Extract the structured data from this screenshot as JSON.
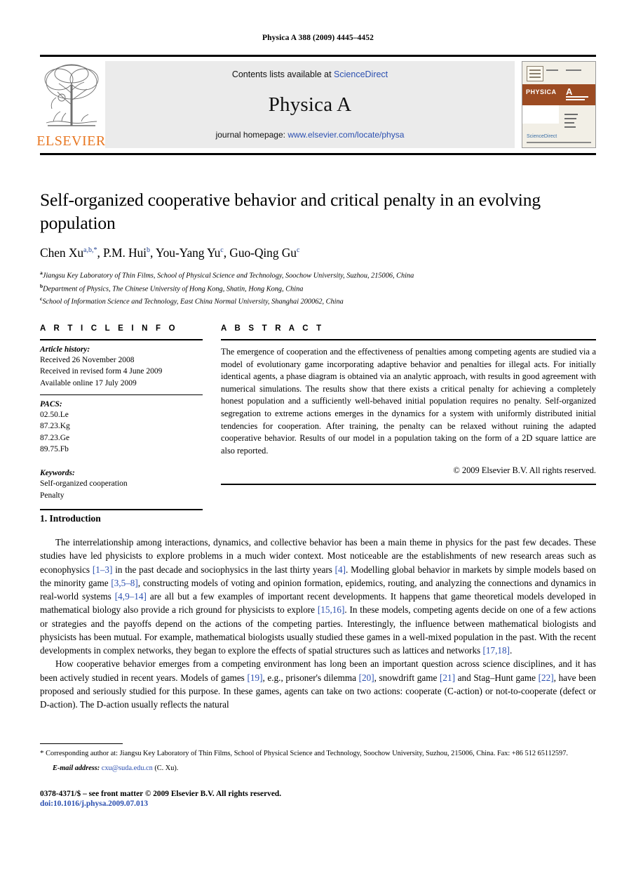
{
  "running_head": "Physica A 388 (2009) 4445–4452",
  "masthead": {
    "publisher_name": "ELSEVIER",
    "contents_prefix": "Contents lists available at ",
    "contents_link": "ScienceDirect",
    "journal_title": "Physica A",
    "homepage_prefix": "journal homepage: ",
    "homepage_link": "www.elsevier.com/locate/physa",
    "cover": {
      "brand": "PHYSICA",
      "brand_letter": "A",
      "sciencedirect_label": "ScienceDirect"
    }
  },
  "article": {
    "title": "Self-organized cooperative behavior and critical penalty in an evolving population",
    "authors_html": "Chen Xu<sup>a,b,*</sup>, P.M. Hui<sup>b</sup>, You-Yang Yu<sup>c</sup>, Guo-Qing Gu<sup>c</sup>",
    "affiliations": [
      {
        "marker": "a",
        "text": "Jiangsu Key Laboratory of Thin Films, School of Physical Science and Technology, Soochow University, Suzhou, 215006, China"
      },
      {
        "marker": "b",
        "text": "Department of Physics, The Chinese University of Hong Kong, Shatin, Hong Kong, China"
      },
      {
        "marker": "c",
        "text": "School of Information Science and Technology, East China Normal University, Shanghai 200062, China"
      }
    ]
  },
  "info": {
    "heading": "A R T I C L E   I N F O",
    "history_label": "Article history:",
    "history": [
      "Received 26 November 2008",
      "Received in revised form 4 June 2009",
      "Available online 17 July 2009"
    ],
    "pacs_label": "PACS:",
    "pacs": [
      "02.50.Le",
      "87.23.Kg",
      "87.23.Ge",
      "89.75.Fb"
    ],
    "keywords_label": "Keywords:",
    "keywords": [
      "Self-organized cooperation",
      "Penalty"
    ]
  },
  "abstract": {
    "heading": "A B S T R A C T",
    "text": "The emergence of cooperation and the effectiveness of penalties among competing agents are studied via a model of evolutionary game incorporating adaptive behavior and penalties for illegal acts. For initially identical agents, a phase diagram is obtained via an analytic approach, with results in good agreement with numerical simulations. The results show that there exists a critical penalty for achieving a completely honest population and a sufficiently well-behaved initial population requires no penalty. Self-organized segregation to extreme actions emerges in the dynamics for a system with uniformly distributed initial tendencies for cooperation. After training, the penalty can be relaxed without ruining the adapted cooperative behavior. Results of our model in a population taking on the form of a 2D square lattice are also reported.",
    "copyright": "© 2009 Elsevier B.V. All rights reserved."
  },
  "section": {
    "number_title": "1. Introduction",
    "paragraph_1_html": "The interrelationship among interactions, dynamics, and collective behavior has been a main theme in physics for the past few decades. These studies have led physicists to explore problems in a much wider context. Most noticeable are the establishments of new research areas such as econophysics <span class=\"cite\">[1–3]</span> in the past decade and sociophysics in the last thirty years <span class=\"cite\">[4]</span>. Modelling global behavior in markets by simple models based on the minority game <span class=\"cite\">[3,5–8]</span>, constructing models of voting and opinion formation, epidemics, routing, and analyzing the connections and dynamics in real-world systems <span class=\"cite\">[4,9–14]</span> are all but a few examples of important recent developments. It happens that game theoretical models developed in mathematical biology also provide a rich ground for physicists to explore <span class=\"cite\">[15,16]</span>. In these models, competing agents decide on one of a few actions or strategies and the payoffs depend on the actions of the competing parties. Interestingly, the influence between mathematical biologists and physicists has been mutual. For example, mathematical biologists usually studied these games in a well-mixed population in the past. With the recent developments in complex networks, they began to explore the effects of spatial structures such as lattices and networks <span class=\"cite\">[17,18]</span>.",
    "paragraph_2_html": "How cooperative behavior emerges from a competing environment has long been an important question across science disciplines, and it has been actively studied in recent years. Models of games <span class=\"cite\">[19]</span>, e.g., prisoner's dilemma <span class=\"cite\">[20]</span>, snowdrift game <span class=\"cite\">[21]</span> and Stag–Hunt game <span class=\"cite\">[22]</span>, have been proposed and seriously studied for this purpose. In these games, agents can take on two actions: cooperate (C-action) or not-to-cooperate (defect or D-action). The D-action usually reflects the natural"
  },
  "footnotes": {
    "corresponding_html": "<span class=\"star\">*</span> Corresponding author at: Jiangsu Key Laboratory of Thin Films, School of Physical Science and Technology, Soochow University, Suzhou, 215006, China. Fax: +86 512 65112597.",
    "email_label": "E-mail address:",
    "email_address": "cxu@suda.edu.cn",
    "email_suffix": "(C. Xu)."
  },
  "colophon": {
    "front_matter": "0378-4371/$ – see front matter © 2009 Elsevier B.V. All rights reserved.",
    "doi": "doi:10.1016/j.physa.2009.07.013"
  },
  "colors": {
    "link": "#2b4fb0",
    "elsevier_orange": "#E87722",
    "banner_bg": "#ebebeb",
    "cover_band": "#9c4b22"
  }
}
